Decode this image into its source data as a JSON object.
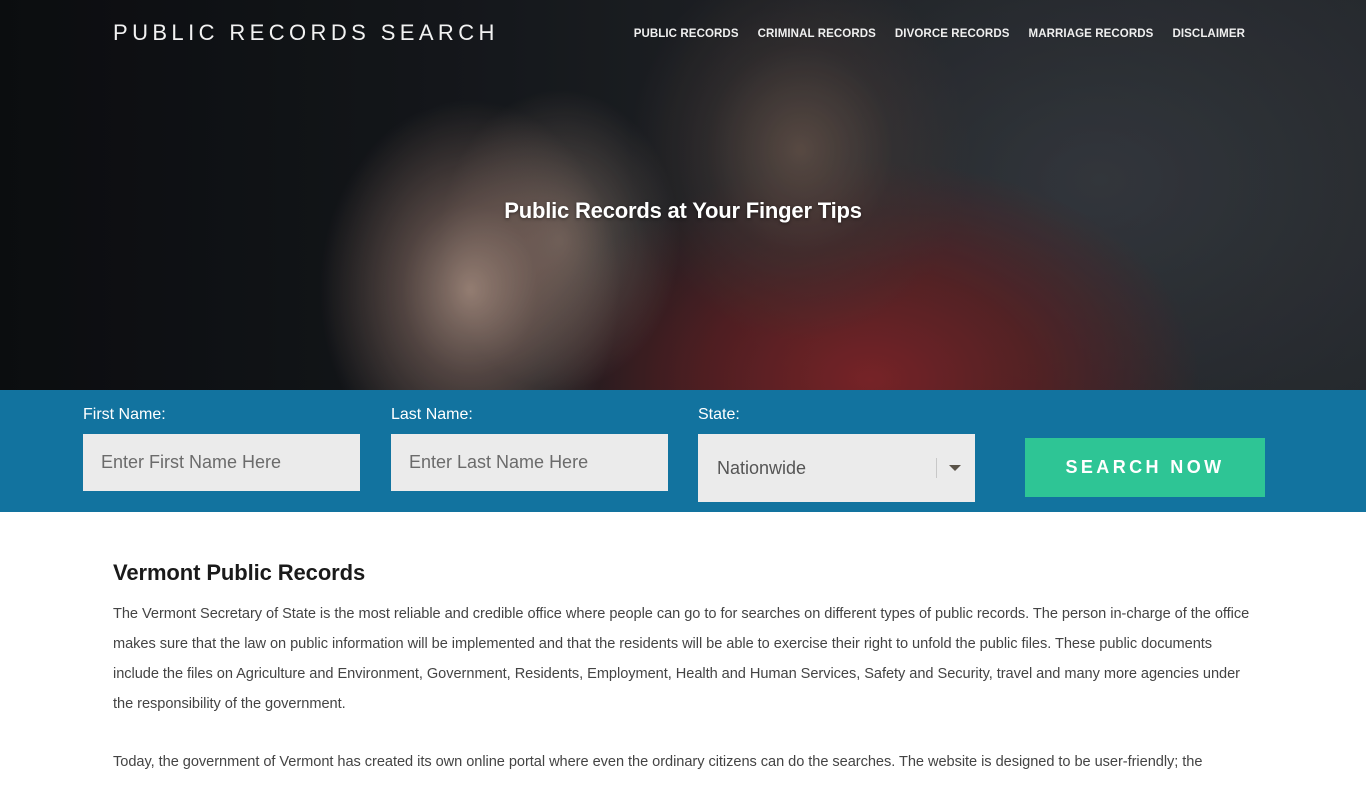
{
  "header": {
    "logo": "PUBLIC RECORDS SEARCH",
    "nav": [
      {
        "label": "PUBLIC RECORDS"
      },
      {
        "label": "CRIMINAL RECORDS"
      },
      {
        "label": "DIVORCE RECORDS"
      },
      {
        "label": "MARRIAGE RECORDS"
      },
      {
        "label": "DISCLAIMER"
      }
    ]
  },
  "hero": {
    "title": "Public Records at Your Finger Tips"
  },
  "search": {
    "first_name": {
      "label": "First Name:",
      "placeholder": "Enter First Name Here",
      "value": ""
    },
    "last_name": {
      "label": "Last Name:",
      "placeholder": "Enter Last Name Here",
      "value": ""
    },
    "state": {
      "label": "State:",
      "selected": "Nationwide"
    },
    "button_label": "SEARCH NOW",
    "colors": {
      "bar": "#12739f",
      "button": "#2ec595",
      "input": "#ebebeb"
    }
  },
  "article": {
    "title": "Vermont Public Records",
    "paragraphs": [
      "The Vermont Secretary of State is the most reliable and credible office where people can go to for searches on different types of public records. The person in-charge of the office makes sure that the law on public information will be implemented and that the residents will be able to exercise their right to unfold the public files. These public documents include the files on Agriculture and Environment, Government, Residents, Employment, Health and Human Services, Safety and Security, travel and many more agencies under the responsibility of the government.",
      "Today, the government of Vermont has created its own online portal where even the ordinary citizens can do the searches. The website is designed to be user-friendly; the"
    ]
  }
}
